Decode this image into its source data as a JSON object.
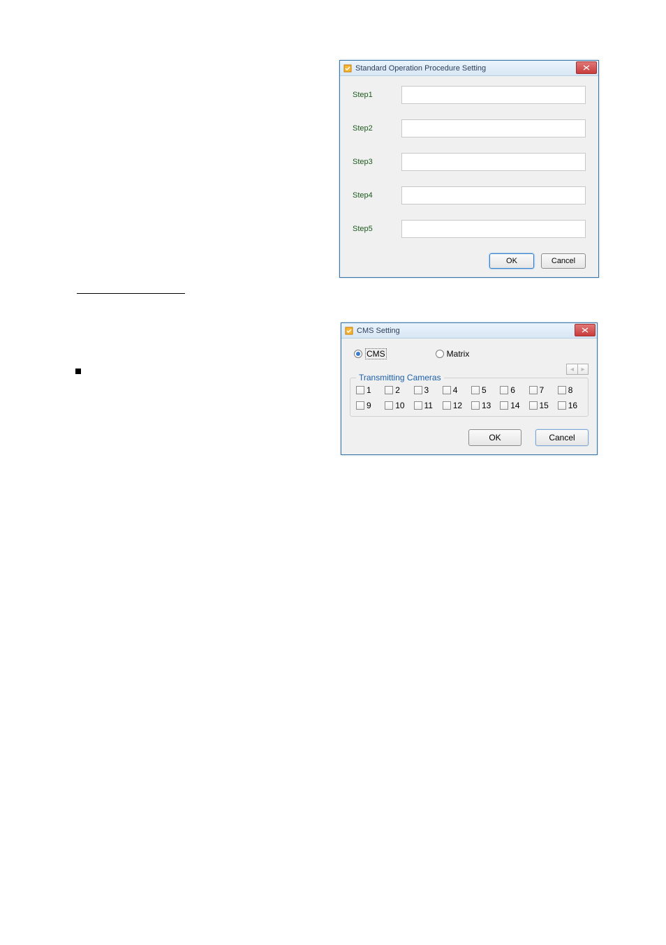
{
  "sop": {
    "title": "Standard Operation Procedure Setting",
    "steps": {
      "s1": "Step1",
      "s2": "Step2",
      "s3": "Step3",
      "s4": "Step4",
      "s5": "Step5"
    },
    "ok": "OK",
    "cancel": "Cancel"
  },
  "cms": {
    "title": "CMS Setting",
    "radio_cms": "CMS",
    "radio_matrix": "Matrix",
    "group_title": "Transmitting Cameras",
    "cameras": {
      "c1": "1",
      "c2": "2",
      "c3": "3",
      "c4": "4",
      "c5": "5",
      "c6": "6",
      "c7": "7",
      "c8": "8",
      "c9": "9",
      "c10": "10",
      "c11": "11",
      "c12": "12",
      "c13": "13",
      "c14": "14",
      "c15": "15",
      "c16": "16"
    },
    "ok": "OK",
    "cancel": "Cancel"
  }
}
